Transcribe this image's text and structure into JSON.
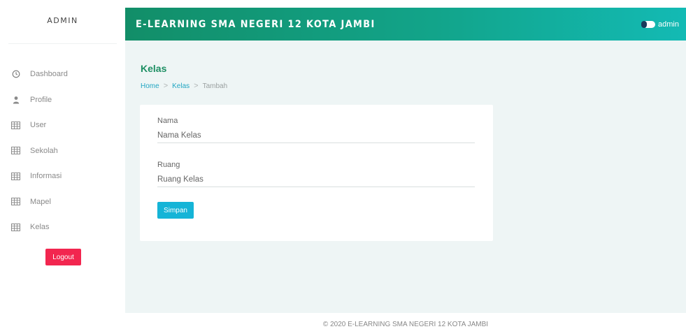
{
  "sidebar": {
    "brand": "ADMIN",
    "items": [
      {
        "label": "Dashboard",
        "icon": "clock-icon"
      },
      {
        "label": "Profile",
        "icon": "user-icon"
      },
      {
        "label": "User",
        "icon": "table-icon"
      },
      {
        "label": "Sekolah",
        "icon": "table-icon"
      },
      {
        "label": "Informasi",
        "icon": "table-icon"
      },
      {
        "label": "Mapel",
        "icon": "table-icon"
      },
      {
        "label": "Kelas",
        "icon": "table-icon"
      }
    ],
    "logout_label": "Logout"
  },
  "header": {
    "title": "E-LEARNING SMA NEGERI 12 KOTA JAMBI",
    "username": "admin"
  },
  "main": {
    "page_title": "Kelas",
    "breadcrumb": {
      "home": "Home",
      "separator": ">",
      "section": "Kelas",
      "current": "Tambah"
    },
    "form": {
      "nama_label": "Nama",
      "nama_placeholder": "Nama Kelas",
      "ruang_label": "Ruang",
      "ruang_placeholder": "Ruang Kelas",
      "save_label": "Simpan"
    }
  },
  "footer": {
    "text": "© 2020 E-LEARNING SMA NEGERI 12 KOTA JAMBI"
  },
  "colors": {
    "brand_green": "#1d8f63",
    "header_gradient_start": "#128e68",
    "header_gradient_end": "#13bab4",
    "primary_button": "#15b4d7",
    "logout_button": "#f2264f",
    "content_background": "#eef5f5"
  }
}
